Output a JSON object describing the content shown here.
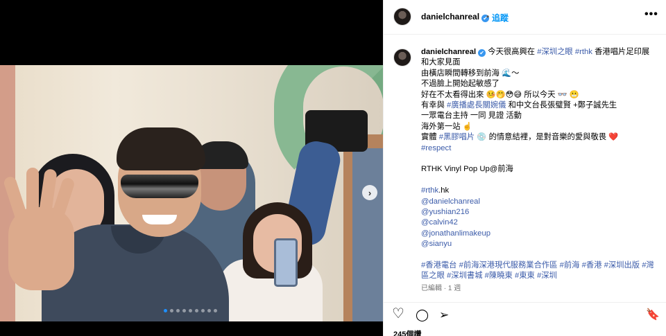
{
  "post": {
    "username": "danielchanreal",
    "verified_badge": "✔",
    "separator": "•",
    "follow_label": "追蹤",
    "more_icon": "more-options-icon",
    "more_glyph": "•••"
  },
  "media": {
    "next_glyph": "›",
    "carousel_count": 9,
    "carousel_active": 1
  },
  "caption": {
    "line1_text": "今天很高興在",
    "line1_tag1": "#深圳之眼",
    "line1_tag2": "#rthk",
    "line1_tail": "香港唱片足印展",
    "line2": "和大家見面",
    "line3": "由橫店瞬間轉移到前海 🌊～",
    "line4": "不過臉上開始起敏感了",
    "line5": "好在不太看得出來 🤒🤭😳😅 所以今天 👓 😬",
    "line6_pre": "有幸與",
    "line6_tag": "#廣播處長關婉儀",
    "line6_post": "和中文台長張璧賢 +鄭子誠先生",
    "line7": "一眾電台主持 一同 見證 活動",
    "line8": "海外第一站 ☝️",
    "line9_pre": "實體",
    "line9_tag": "#黑膠唱片",
    "line9_post": "💿 的情意結裡，是對音樂的愛與敬畏 ❤️",
    "line10_tag": "#respect",
    "line11": "RTHK Vinyl Pop Up@前海",
    "line12_tag": "#rthk",
    "line12_post": ".hk",
    "mentions": [
      "@danielchanreal",
      "@yushian216",
      "@calvin42",
      "@jonathanlimakeup",
      "@sianyu"
    ],
    "hashtags_line1": "#香港電台 #前海深港現代服務業合作區 #前海 #香港 #深圳出版 #灣",
    "hashtags_line2": "區之眼 #深圳書城 #陳曉東 #東東 #深圳",
    "meta": "已編輯 · 1 週"
  },
  "actions": {
    "like_icon": "heart-icon",
    "like_glyph": "♡",
    "comment_icon": "comment-icon",
    "comment_glyph": "◯",
    "share_icon": "send-icon",
    "share_glyph": "➢",
    "save_icon": "bookmark-icon",
    "save_glyph": "🔖",
    "likes": "245個讚"
  },
  "colors": {
    "link_blue": "#0095f6",
    "hashtag": "#3b5ba9",
    "carousel_active": "#1e90ff"
  }
}
